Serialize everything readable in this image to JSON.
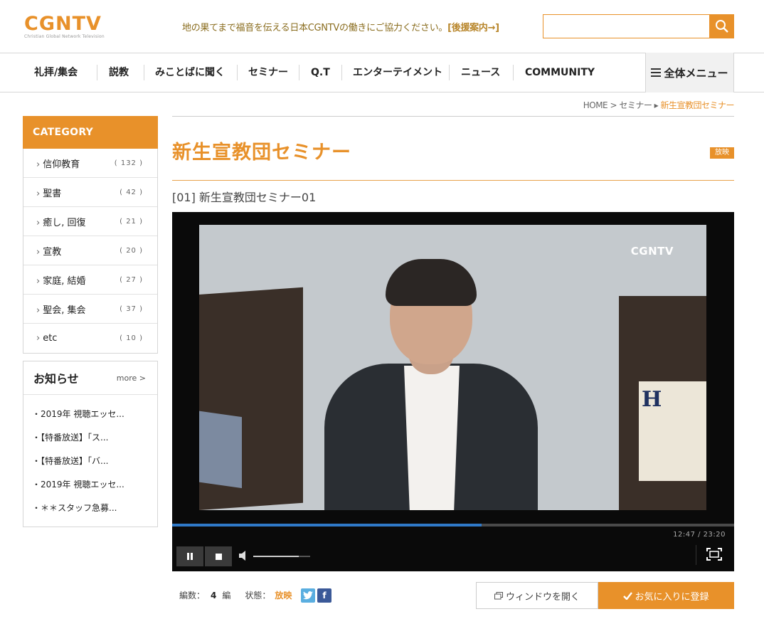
{
  "header": {
    "logo_text": "CGNTV",
    "logo_sub": "Christian Global Network Television",
    "donate_text": "地の果てまで福音を伝える日本CGNTVの働きにご協力ください。",
    "donate_link": "[後援案内→]",
    "search": {
      "value": "",
      "placeholder": ""
    }
  },
  "nav": {
    "items": [
      "礼拝/集会",
      "説教",
      "みことばに聞く",
      "セミナー",
      "Q.T",
      "エンターテイメント",
      "ニュース",
      "COMMUNITY"
    ],
    "all_menu": "全体メニュー"
  },
  "breadcrumb": {
    "home": "HOME",
    "sep1": " > ",
    "section": "セミナー",
    "sep2": " ▸ ",
    "current": "新生宣教団セミナー"
  },
  "sidebar": {
    "category_title": "CATEGORY",
    "categories": [
      {
        "name": "信仰教育",
        "count": "( 132 )"
      },
      {
        "name": "聖書",
        "count": "( 42 )"
      },
      {
        "name": "癒し, 回復",
        "count": "( 21 )"
      },
      {
        "name": "宣教",
        "count": "( 20 )"
      },
      {
        "name": "家庭, 結婚",
        "count": "( 27 )"
      },
      {
        "name": "聖会, 集会",
        "count": "( 37 )"
      },
      {
        "name": "etc",
        "count": "( 10 )"
      }
    ],
    "notice": {
      "title": "お知らせ",
      "more": "more >",
      "items": [
        "2019年 視聴エッセ...",
        "【特番放送】「ス...",
        "【特番放送】「バ...",
        "2019年 視聴エッセ...",
        "＊＊スタッフ急募..."
      ]
    }
  },
  "main": {
    "title": "新生宣教団セミナー",
    "status_badge": "放映",
    "episode_title": "[01] 新生宣教団セミナー01",
    "player": {
      "watermark": "CGNTV",
      "time": "12:47 / 23:20",
      "progress": 0.55,
      "volume": 0.8
    },
    "meta": {
      "episodes_label": "編数：",
      "episodes_count": "4",
      "episodes_unit": "編",
      "status_label": "状態：",
      "status_value": "放映"
    },
    "buttons": {
      "open_window": "ウィンドウを開く",
      "add_favorite": "お気に入りに登録"
    }
  },
  "colors": {
    "accent": "#e8912a",
    "progress": "#2f79c8"
  }
}
